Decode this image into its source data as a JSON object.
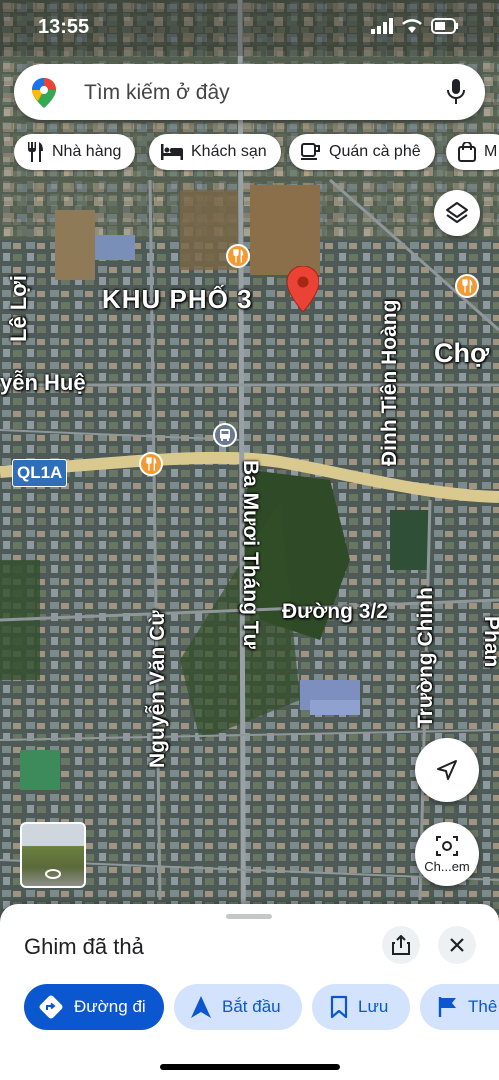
{
  "status": {
    "time": "13:55"
  },
  "search": {
    "placeholder": "Tìm kiếm ở đây"
  },
  "chips": [
    {
      "label": "Nhà hàng",
      "icon": "restaurant-icon"
    },
    {
      "label": "Khách sạn",
      "icon": "hotel-icon"
    },
    {
      "label": "Quán cà phê",
      "icon": "coffee-icon"
    },
    {
      "label": "M",
      "icon": "shopping-bag-icon"
    }
  ],
  "map": {
    "area_label": "KHU PHỐ 3",
    "highway_badge": "QL1A",
    "market_label": "Chợ",
    "streets": {
      "le_loi": "Lê Lợi",
      "nguyen_hue": "yễn Huệ",
      "dinh_tien_hoang": "Đinh Tiên Hoàng",
      "ba_muoi_thang_tu": "Ba Mươi Tháng Tư",
      "duong_3_2": "Đường 3/2",
      "nguyen_van_cu": "Nguyễn Văn Cừ",
      "truong_chinh": "Trường Chinh",
      "phan": "Phan"
    }
  },
  "street_view": {
    "label": "Ch...em"
  },
  "sheet": {
    "title": "Ghim đã thả",
    "actions": [
      {
        "label": "Đường đi",
        "icon": "directions-icon"
      },
      {
        "label": "Bắt đầu",
        "icon": "navigation-arrow-icon"
      },
      {
        "label": "Lưu",
        "icon": "bookmark-icon"
      },
      {
        "label": "Thê",
        "icon": "flag-icon"
      }
    ]
  },
  "colors": {
    "accent": "#0b57d0",
    "pin": "#ea4335",
    "primary_button": "#0b57d0",
    "secondary_button": "#d3e3fd"
  }
}
